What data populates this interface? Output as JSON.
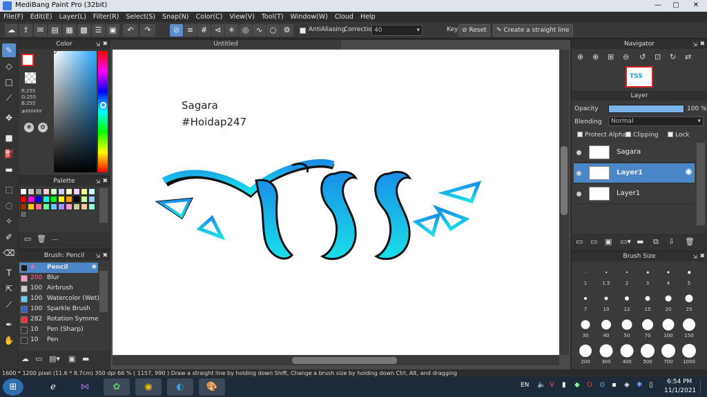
{
  "app": {
    "title": "MediBang Paint Pro (32bit)"
  },
  "menu": [
    "File(F)",
    "Edit(E)",
    "Layer(L)",
    "Filter(R)",
    "Select(S)",
    "Snap(N)",
    "Color(C)",
    "View(V)",
    "Tool(T)",
    "Window(W)",
    "Cloud",
    "Help"
  ],
  "toolbar": {
    "antialiasing_label": "AntiAliasing",
    "correction_label": "Correction",
    "correction_value": "40",
    "key_label": "Key",
    "reset_label": "Reset",
    "straight_line_label": "Create a straight line"
  },
  "color_panel": {
    "title": "Color",
    "r": "R:255",
    "g": "G:255",
    "b": "B:255",
    "hex": "#FFFFFF"
  },
  "palette_panel": {
    "title": "Palette",
    "colors": [
      "#ffffff",
      "#cccccc",
      "#999999",
      "#ffcccc",
      "#ccffcc",
      "#ccccff",
      "#ffffcc",
      "#ffccff",
      "#ffff99",
      "#ccffff",
      "#ff0000",
      "#ff00ff",
      "#0000ff",
      "#00ffff",
      "#00ff00",
      "#ffff00",
      "#ff9900",
      "#000000",
      "#ccff99",
      "#99ccff",
      "#993300",
      "#ffcc00",
      "#ff6699",
      "#66ff99",
      "#66ccff",
      "#9999ff",
      "#ff99cc",
      "#cccc99",
      "#ffcc99",
      "#99ffcc",
      "#666666"
    ],
    "more_label": "---"
  },
  "brush_panel": {
    "title": "Brush: Pencil",
    "brushes": [
      {
        "size": "4",
        "name": "Pencil",
        "color": "#1a1a1a"
      },
      {
        "size": "200",
        "name": "Blur",
        "color": "#ff99cc"
      },
      {
        "size": "100",
        "name": "Airbrush",
        "color": "#cccccc"
      },
      {
        "size": "100",
        "name": "Watercolor (Wet)",
        "color": "#66ccff"
      },
      {
        "size": "100",
        "name": "Sparkle Brush",
        "color": "#3366cc"
      },
      {
        "size": "282",
        "name": "Rotation Symmetry",
        "color": "#ff3333"
      },
      {
        "size": "10",
        "name": "Pen (Sharp)",
        "color": "#333333"
      },
      {
        "size": "10",
        "name": "Pen",
        "color": "#333333"
      }
    ]
  },
  "document": {
    "tab": "Untitled",
    "text_line1": "Sagara",
    "text_line2": "#Hoidap247",
    "logo_text": "TSS"
  },
  "navigator": {
    "title": "Navigator"
  },
  "layer_panel": {
    "title": "Layer",
    "opacity_label": "Opacity",
    "opacity_value": "100 %",
    "opacity": 1.0,
    "blending_label": "Blending",
    "blending_value": "Normal",
    "protect_alpha": "Protect Alpha",
    "clipping": "Clipping",
    "lock": "Lock",
    "layers": [
      {
        "name": "Sagara"
      },
      {
        "name": "Layer1"
      },
      {
        "name": "Layer1"
      }
    ]
  },
  "brush_size_panel": {
    "title": "Brush Size",
    "sizes": [
      "1",
      "1.5",
      "2",
      "3",
      "4",
      "5",
      "7",
      "10",
      "12",
      "15",
      "20",
      "25",
      "30",
      "40",
      "50",
      "70",
      "100",
      "150",
      "200",
      "300",
      "400",
      "500",
      "700",
      "1000"
    ]
  },
  "status": {
    "text": "1600 * 1200 pixel   (11.6 * 8.7cm)   350 dpi   66 %   ( 1157, 990 )   Draw a straight line by holding down Shift, Change a brush size by holding down Ctrl, Alt, and dragging"
  },
  "taskbar": {
    "lang": "EN",
    "time": "6:54 PM",
    "date": "11/1/2021"
  },
  "colors": {
    "accent": "#4b87c8",
    "logo_blue": "#1aa3e8",
    "logo_cyan": "#19d5e6"
  }
}
